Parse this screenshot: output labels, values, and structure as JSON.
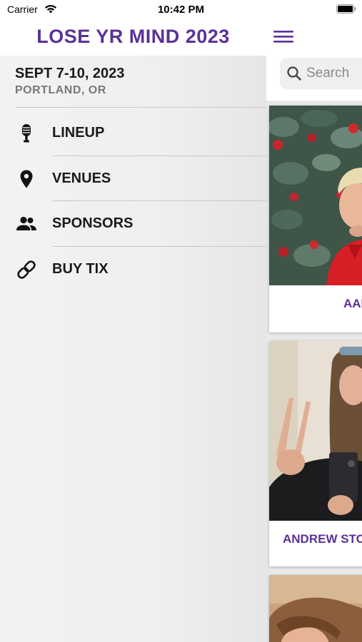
{
  "status_bar": {
    "carrier": "Carrier",
    "time": "10:42 PM"
  },
  "drawer": {
    "title": "LOSE YR MIND 2023",
    "dates": "SEPT 7-10, 2023",
    "location": "PORTLAND, OR",
    "items": [
      {
        "label": "LINEUP",
        "icon": "microphone-icon"
      },
      {
        "label": "VENUES",
        "icon": "location-pin-icon"
      },
      {
        "label": "SPONSORS",
        "icon": "people-icon"
      },
      {
        "label": "BUY TIX",
        "icon": "link-icon"
      }
    ]
  },
  "main": {
    "search_placeholder": "Search",
    "artists": [
      {
        "name": "AAI"
      },
      {
        "name": "ANDREW STO"
      },
      {
        "name": ""
      }
    ]
  },
  "colors": {
    "accent": "#5b3196",
    "drawer_bg": "#efefef",
    "divider": "#c8c8c8"
  }
}
